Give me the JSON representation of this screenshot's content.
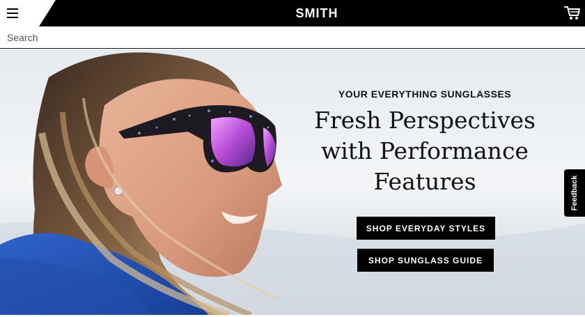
{
  "header": {
    "logo_text": "SMITH",
    "menu_icon": "hamburger-menu-icon",
    "cart_icon": "shopping-cart-icon"
  },
  "search": {
    "placeholder": "Search"
  },
  "hero": {
    "eyebrow": "YOUR EVERYTHING SUNGLASSES",
    "headline_lines": [
      "Fresh Perspectives",
      "with Performance",
      "Features"
    ],
    "buttons": {
      "everyday": "SHOP EVERYDAY STYLES",
      "guide": "SHOP SUNGLASS GUIDE"
    }
  },
  "feedback": {
    "label": "Feedback"
  },
  "colors": {
    "header_bg": "#000000",
    "button_bg": "#000000",
    "button_text": "#ffffff",
    "lens_tint": "#b64bd6"
  }
}
